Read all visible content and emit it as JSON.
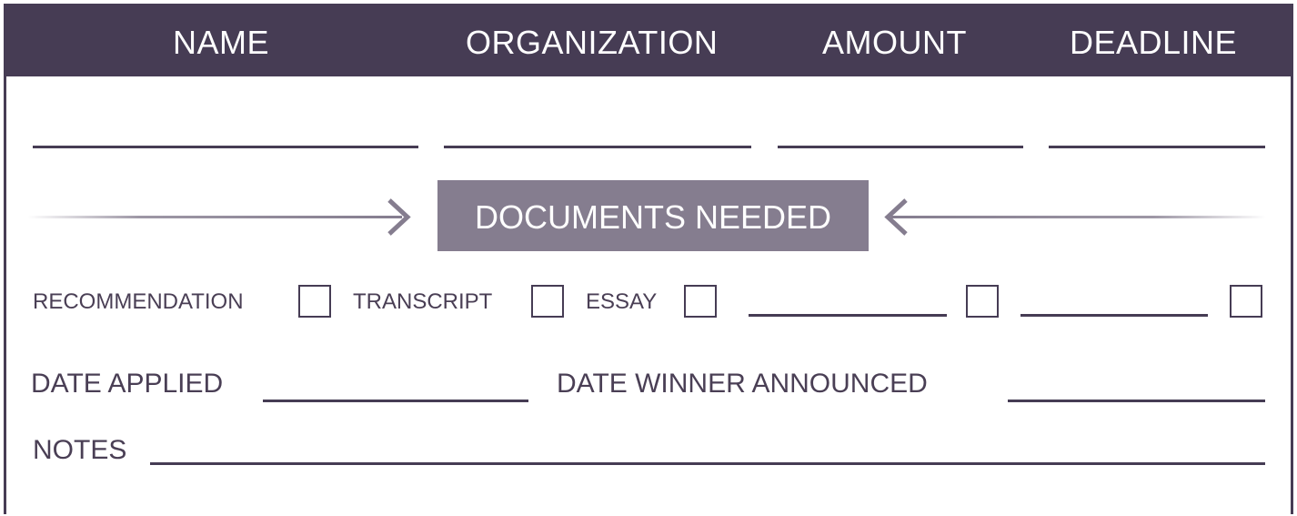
{
  "header": {
    "name": "NAME",
    "organization": "ORGANIZATION",
    "amount": "AMOUNT",
    "deadline": "DEADLINE"
  },
  "documents": {
    "title": "DOCUMENTS NEEDED",
    "items": [
      "RECOMMENDATION",
      "TRANSCRIPT",
      "ESSAY"
    ]
  },
  "dates": {
    "applied_label": "DATE APPLIED",
    "winner_label": "DATE WINNER ANNOUNCED"
  },
  "notes": {
    "label": "NOTES"
  },
  "colors": {
    "header_bg": "#463c54",
    "banner_bg": "#857d8f",
    "text": "#4a3f55"
  }
}
